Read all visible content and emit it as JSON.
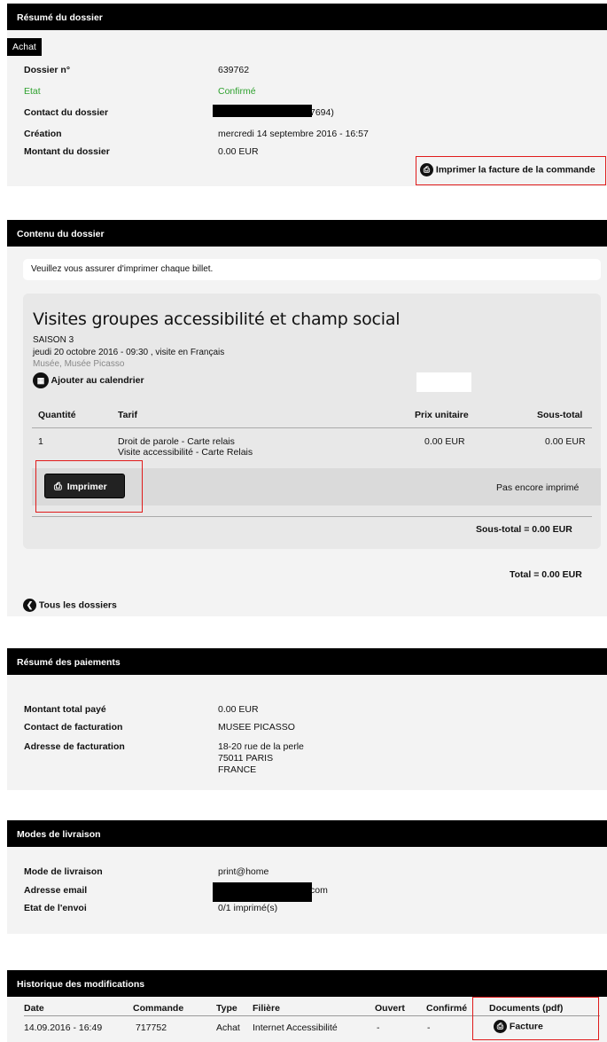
{
  "summary": {
    "header": "Résumé du dossier",
    "tag": "Achat",
    "rows": [
      {
        "label": "Dossier n°",
        "value": "639762"
      },
      {
        "label": "Etat",
        "value": "Confirmé"
      },
      {
        "label": "Contact du dossier",
        "value": "7694)"
      },
      {
        "label": "Création",
        "value": "mercredi 14 septembre 2016 - 16:57"
      },
      {
        "label": "Montant du dossier",
        "value": "0.00 EUR"
      }
    ],
    "print_invoice": "Imprimer la facture de la commande"
  },
  "content": {
    "header": "Contenu du dossier",
    "notice": "Veuillez vous assurer d'imprimer chaque billet.",
    "event": {
      "title": "Visites groupes accessibilité et champ social",
      "season": "SAISON 3",
      "date": "jeudi 20 octobre 2016 - 09:30 , visite en Français",
      "venue": "Musée, Musée Picasso",
      "add_calendar": "Ajouter au calendrier"
    },
    "table": {
      "headers": [
        "Quantité",
        "Tarif",
        "Prix unitaire",
        "Sous-total"
      ],
      "row": {
        "qty": "1",
        "tarif_line1": "Droit de parole - Carte relais",
        "tarif_line2": "Visite accessibilité - Carte Relais",
        "unit": "0.00 EUR",
        "subtotal": "0.00 EUR"
      }
    },
    "print_button": "Imprimer",
    "print_status": "Pas encore imprimé",
    "subtotal": "Sous-total = 0.00 EUR",
    "total": "Total = 0.00 EUR",
    "all_files": "Tous les dossiers"
  },
  "payments": {
    "header": "Résumé des paiements",
    "rows": [
      {
        "label": "Montant total payé",
        "value": "0.00 EUR"
      },
      {
        "label": "Contact de facturation",
        "value": "MUSEE PICASSO"
      },
      {
        "label": "Adresse de facturation",
        "value": "18-20 rue de la perle"
      }
    ],
    "address_line2": "75011 PARIS",
    "address_line3": "FRANCE"
  },
  "delivery": {
    "header": "Modes de livraison",
    "rows": [
      {
        "label": "Mode de livraison",
        "value": "print@home"
      },
      {
        "label": "Adresse email",
        "value": "com"
      },
      {
        "label": "Etat de l'envoi",
        "value": "0/1 imprimé(s)"
      }
    ]
  },
  "history": {
    "header": "Historique des modifications",
    "headers": [
      "Date",
      "Commande",
      "Type",
      "Filière",
      "Ouvert",
      "Confirmé",
      "Documents (pdf)"
    ],
    "row": {
      "date": "14.09.2016 - 16:49",
      "order": "717752",
      "type": "Achat",
      "channel": "Internet Accessibilité",
      "open": "-",
      "confirmed": "-",
      "doc": "Facture"
    }
  }
}
